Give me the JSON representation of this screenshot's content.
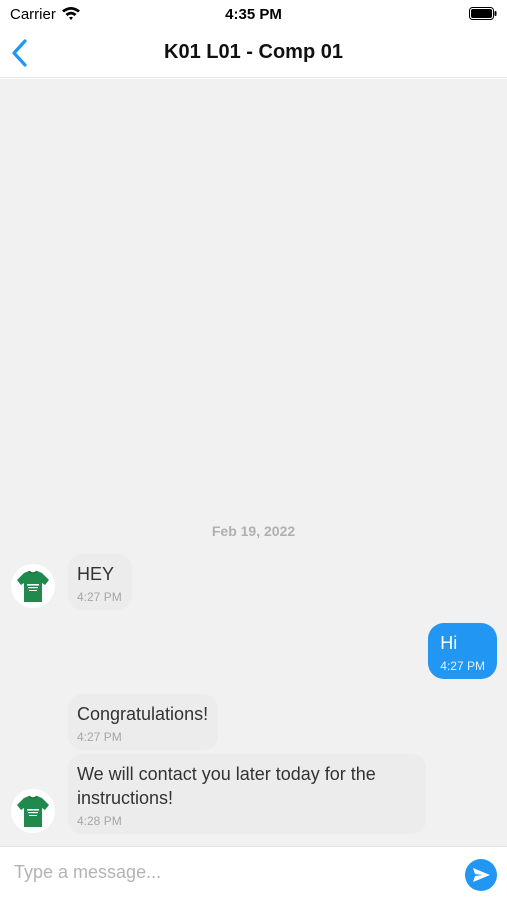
{
  "status_bar": {
    "carrier": "Carrier",
    "time": "4:35 PM"
  },
  "nav": {
    "title": "K01 L01 - Comp 01"
  },
  "chat": {
    "date_separator": "Feb 19, 2022",
    "messages": [
      {
        "text": "HEY",
        "time": "4:27 PM"
      },
      {
        "text": "Hi",
        "time": "4:27 PM"
      },
      {
        "text": "Congratulations!",
        "time": "4:27 PM"
      },
      {
        "text": "We will contact you later today for the instructions!",
        "time": "4:28 PM"
      }
    ]
  },
  "composer": {
    "placeholder": "Type a message..."
  },
  "colors": {
    "accent": "#2196f3",
    "chat_background": "#f1f1f1",
    "incoming_bubble": "#ececec",
    "avatar_shirt": "#1f8a4c"
  },
  "icons": {
    "back": "chevron-left-icon",
    "send": "send-icon",
    "wifi": "wifi-icon",
    "battery": "battery-icon"
  }
}
